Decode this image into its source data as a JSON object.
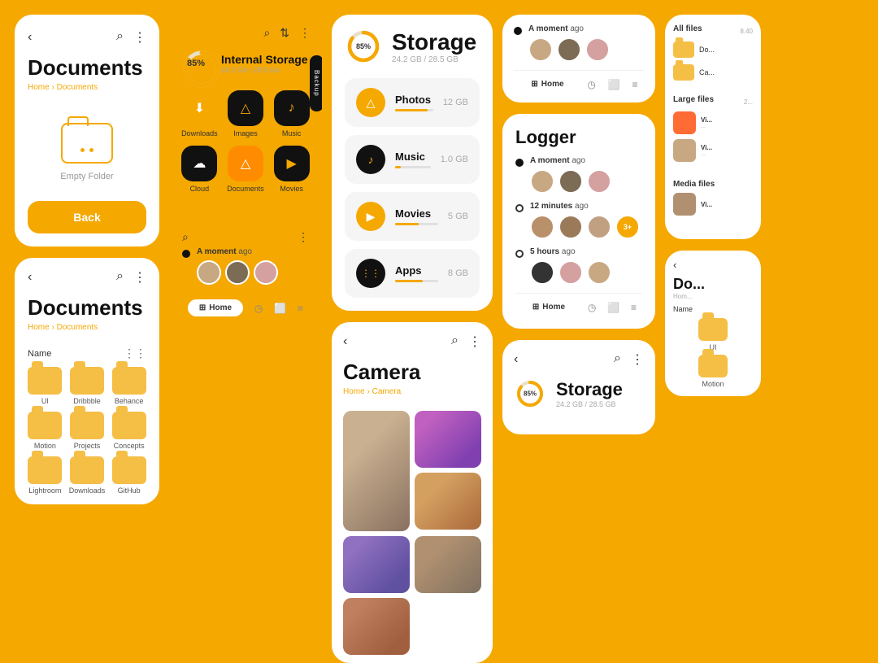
{
  "bg_color": "#F5A800",
  "accent": "#F5A800",
  "col1": {
    "card1": {
      "title": "Documents",
      "breadcrumb_home": "Home",
      "breadcrumb_sep": "›",
      "breadcrumb_current": "Documents",
      "empty_label": "Empty Folder",
      "back_btn": "Back"
    },
    "card2": {
      "title": "Documents",
      "breadcrumb_home": "Home",
      "breadcrumb_sep": "›",
      "breadcrumb_current": "Documents",
      "name_label": "Name",
      "folders": [
        {
          "name": "UI"
        },
        {
          "name": "Dribbble"
        },
        {
          "name": "Behance"
        },
        {
          "name": "Motion"
        },
        {
          "name": "Projects"
        },
        {
          "name": "Concepts"
        },
        {
          "name": "Lightroom"
        },
        {
          "name": "Downloads"
        },
        {
          "name": "GitHub"
        }
      ]
    }
  },
  "col2": {
    "widget": {
      "storage_pct": "85%",
      "storage_title": "Internal Storage",
      "storage_sub": "24.2 Gb / 28.5 Gb",
      "backup_label": "Backup"
    },
    "apps": [
      {
        "label": "Downloads",
        "icon": "⬇",
        "style": "yellow"
      },
      {
        "label": "Images",
        "icon": "△",
        "style": "dark"
      },
      {
        "label": "Music",
        "icon": "♪",
        "style": "dark"
      },
      {
        "label": "Cloud",
        "icon": "☁",
        "style": "dark"
      },
      {
        "label": "Documents",
        "icon": "△",
        "style": "orange"
      },
      {
        "label": "Movies",
        "icon": "▶",
        "style": "dark"
      }
    ],
    "logger": {
      "title": "Logger",
      "activities": [
        {
          "time": "A moment",
          "time_suffix": " ago",
          "avatars": [
            "av1",
            "av2",
            "av3"
          ]
        },
        {
          "time": "12 minutes",
          "time_suffix": " ago",
          "avatars": [
            "av4",
            "av5",
            "av6",
            "plus"
          ]
        },
        {
          "time": "5 hours",
          "time_suffix": " ago",
          "avatars": [
            "dark-av",
            "av3",
            "av1"
          ]
        }
      ],
      "nav": {
        "home": "Home",
        "items": [
          "home-icon",
          "clock-icon",
          "folder-icon",
          "menu-icon"
        ]
      }
    }
  },
  "col3": {
    "storage": {
      "pct": "85%",
      "gb_used": "24.2 GB",
      "gb_total": "28.5 GB",
      "title": "Storage",
      "items": [
        {
          "name": "Photos",
          "size": "12 GB",
          "pct": 85,
          "icon": "△",
          "style": "yellow"
        },
        {
          "name": "Music",
          "size": "1.0 GB",
          "pct": 15,
          "icon": "♪",
          "style": "dark"
        },
        {
          "name": "Movies",
          "size": "5 GB",
          "pct": 55,
          "icon": "▶",
          "style": "yellow"
        },
        {
          "name": "Apps",
          "size": "8 GB",
          "pct": 65,
          "icon": "⋮⋮",
          "style": "dark"
        }
      ]
    },
    "camera": {
      "title": "Camera",
      "breadcrumb_home": "Home",
      "breadcrumb_sep": "›",
      "breadcrumb_current": "Camera",
      "photos": [
        "pt-1",
        "pt-2",
        "pt-3",
        "pt-4",
        "pt-5",
        "pt-6"
      ]
    }
  },
  "col4": {
    "logger_white": {
      "moment_text": "A moment",
      "moment_suffix": " ago",
      "nav_home": "Home",
      "title": "Logger",
      "activities": [
        {
          "time": "A moment",
          "suffix": " ago",
          "avatars": [
            "av1",
            "av2",
            "av3"
          ]
        },
        {
          "time": "12 minutes",
          "suffix": " ago",
          "avatars": [
            "av4",
            "av5",
            "av6",
            "plus"
          ]
        },
        {
          "time": "5 hours",
          "suffix": " ago",
          "avatars": [
            "dark-av",
            "av3",
            "av1"
          ]
        }
      ]
    },
    "storage_mini": {
      "pct": "85%",
      "title": "Storage",
      "gb_label": "24.2 GB / 28.5 GB"
    }
  },
  "col5": {
    "section_all": {
      "title": "All files",
      "size": "8.40",
      "folders": [
        {
          "name": "Do..."
        },
        {
          "name": "Ca..."
        }
      ]
    },
    "section_large": {
      "title": "Large files",
      "size": "2...",
      "items": [
        {
          "name": "Vi...",
          "size": "...",
          "color": "orange"
        },
        {
          "name": "Vi...",
          "size": "...",
          "color": "av1"
        }
      ]
    },
    "section_media": {
      "title": "Media files",
      "items": [
        {
          "name": "Vi...",
          "color": "av4"
        }
      ]
    },
    "mini_doc": {
      "title": "Do...",
      "breadcrumb": "Hom...",
      "name_label": "Name"
    },
    "mini_storage": {
      "pct": "85%",
      "title": "Storage",
      "gb": "24.2 GB / 28.5 GB"
    }
  }
}
